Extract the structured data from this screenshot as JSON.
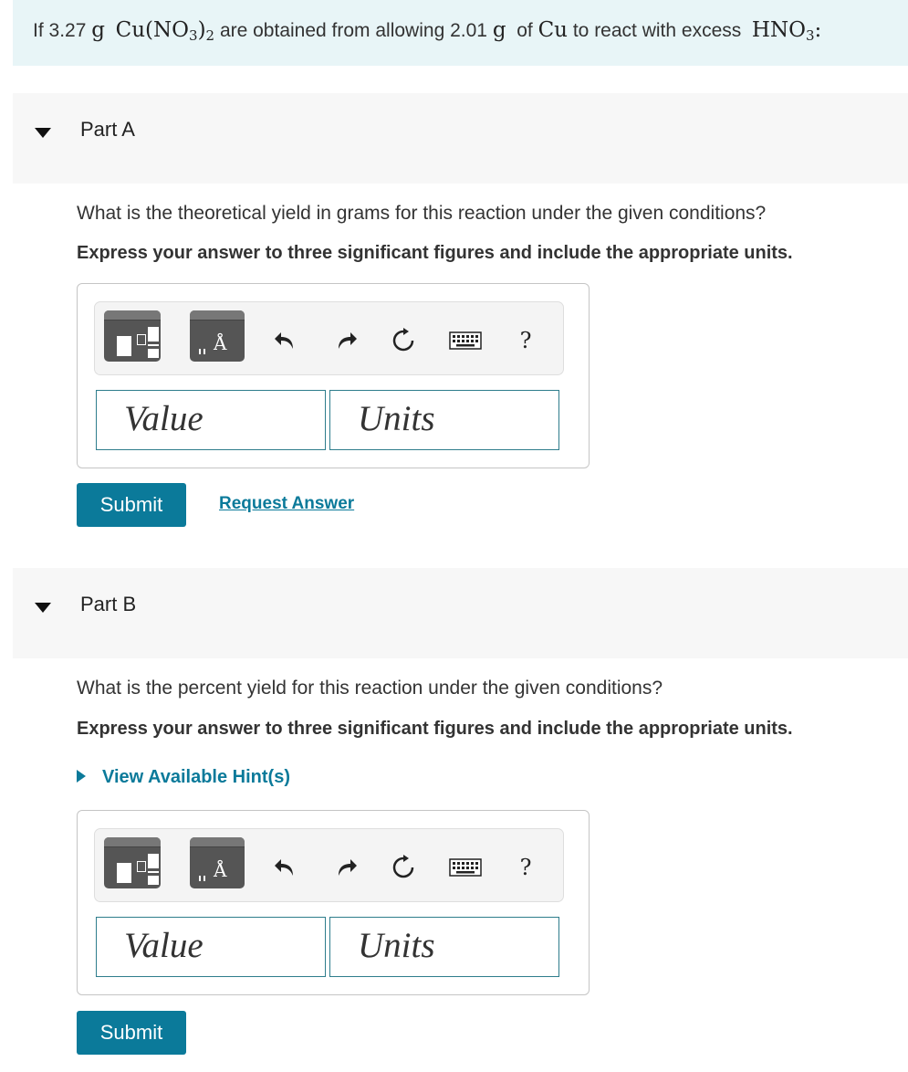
{
  "intro": {
    "t1": "If",
    "mass1": "3.27",
    "unit1": "g",
    "product": "Cu(NO",
    "product_sub": "3",
    "product_close": ")",
    "product_sub2": "2",
    "t2": "are obtained from allowing",
    "mass2": "2.01",
    "unit2": "g",
    "t3": "of",
    "reactant": "Cu",
    "t4": "to react with excess",
    "acid": "HNO",
    "acid_sub": "3",
    "colon": ":"
  },
  "partA": {
    "title": "Part A",
    "question": "What is the theoretical yield in grams for this reaction under the given conditions?",
    "instruction": "Express your answer to three significant figures and include the appropriate units.",
    "value_placeholder": "Value",
    "units_placeholder": "Units",
    "submit_label": "Submit",
    "request_label": "Request Answer"
  },
  "partB": {
    "title": "Part B",
    "question": "What is the percent yield for this reaction under the given conditions?",
    "instruction": "Express your answer to three significant figures and include the appropriate units.",
    "hint_label": "View Available Hint(s)",
    "value_placeholder": "Value",
    "units_placeholder": "Units",
    "submit_label": "Submit"
  },
  "toolbar": {
    "units_symbol": "Å",
    "help_label": "?",
    "icons": [
      "templates-icon",
      "units-icon",
      "undo-icon",
      "redo-icon",
      "reset-icon",
      "keyboard-icon",
      "help-icon"
    ]
  },
  "colors": {
    "accent": "#0b7a9a",
    "intro_bg": "#e8f5f7",
    "header_bg": "#f7f7f7"
  }
}
